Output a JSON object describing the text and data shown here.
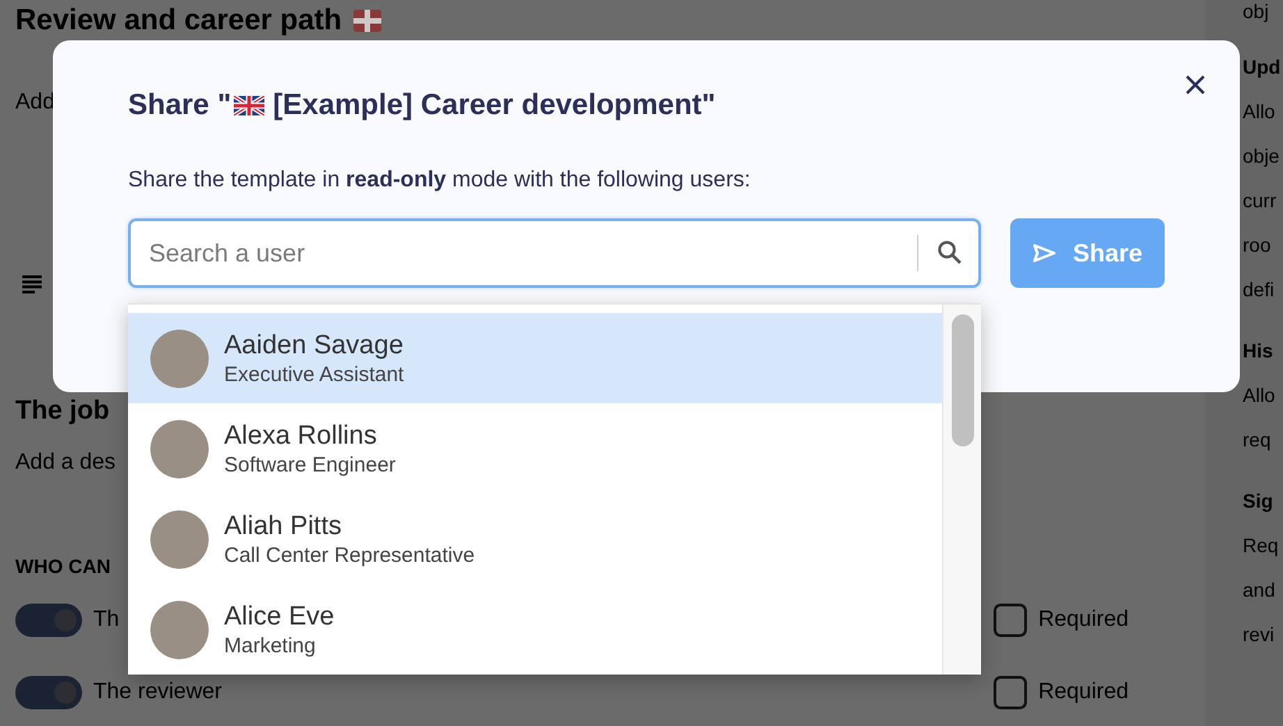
{
  "background": {
    "heading": "Review and career path",
    "note": "Add",
    "section_title": "The job",
    "section_note": "Add a des",
    "permissions_title": "WHO CAN",
    "permissions": [
      {
        "label": "Th",
        "on": true,
        "required_label": "Required",
        "required_checked": false
      },
      {
        "label": "The reviewer",
        "on": true,
        "required_label": "Required",
        "required_checked": false
      }
    ],
    "side_texts": [
      {
        "kind": "text",
        "text": "obj"
      },
      {
        "kind": "heading",
        "text": "Upd"
      },
      {
        "kind": "text",
        "text": "Allo"
      },
      {
        "kind": "text",
        "text": "obje"
      },
      {
        "kind": "text",
        "text": "curr"
      },
      {
        "kind": "text",
        "text": "roo"
      },
      {
        "kind": "text",
        "text": "defi"
      },
      {
        "kind": "heading",
        "text": "His"
      },
      {
        "kind": "text",
        "text": "Allo"
      },
      {
        "kind": "text",
        "text": "req"
      },
      {
        "kind": "heading",
        "text": "Sig"
      },
      {
        "kind": "text",
        "text": "Req"
      },
      {
        "kind": "text",
        "text": "and"
      },
      {
        "kind": "text",
        "text": "revi"
      }
    ]
  },
  "modal": {
    "title_prefix": "Share \"",
    "title_text": "[Example] Career development\"",
    "description": "Share the template in **read-only** mode with the following users:",
    "search": {
      "placeholder": "Search a user"
    },
    "share_button": "Share"
  },
  "users": [
    {
      "name": "Aaiden Savage",
      "role": "Executive Assistant",
      "selected": true
    },
    {
      "name": "Alexa Rollins",
      "role": "Software Engineer",
      "selected": false
    },
    {
      "name": "Aliah Pitts",
      "role": "Call Center Representative",
      "selected": false
    },
    {
      "name": "Alice Eve",
      "role": "Marketing",
      "selected": false
    }
  ]
}
